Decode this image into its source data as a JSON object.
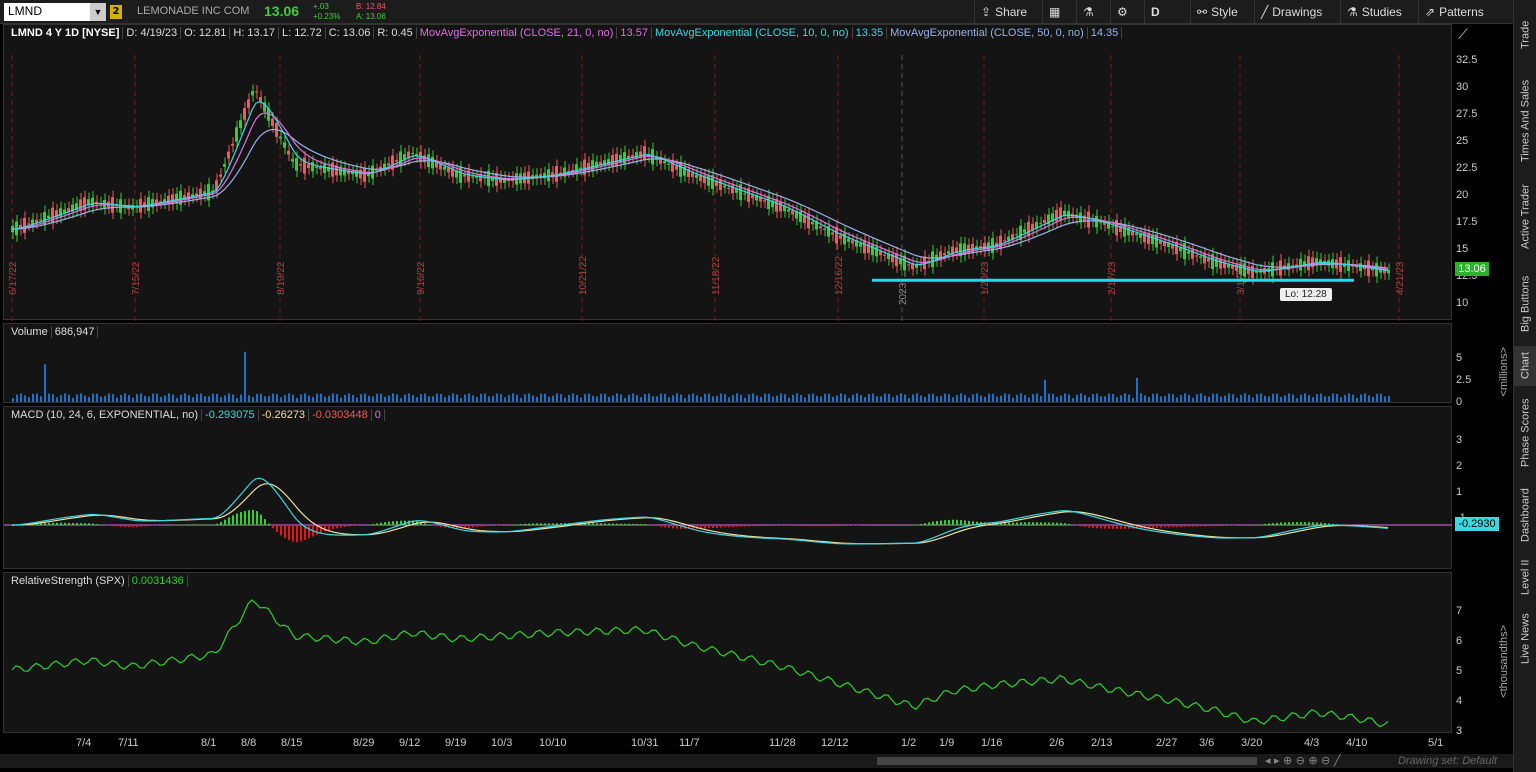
{
  "toolbar": {
    "symbol": "LMND",
    "link_badge": "2",
    "company": "LEMONADE INC COM",
    "last": "13.06",
    "change": "+.03",
    "change_pct": "+0.23%",
    "bid": "B: 12.84",
    "ask": "A: 13.06",
    "share": "Share",
    "period": "D",
    "style": "Style",
    "drawings": "Drawings",
    "studies": "Studies",
    "patterns": "Patterns"
  },
  "price_header": {
    "title": "LMND 4 Y 1D [NYSE]",
    "date": "D: 4/19/23",
    "open": "O: 12.81",
    "high": "H: 13.17",
    "low": "L: 12.72",
    "close": "C: 13.06",
    "range": "R: 0.45",
    "ema21": "MovAvgExponential (CLOSE, 21, 0, no)",
    "ema21_val": "13.57",
    "ema10": "MovAvgExponential (CLOSE, 10, 0, no)",
    "ema10_val": "13.35",
    "ema50": "MovAvgExponential (CLOSE, 50, 0, no)",
    "ema50_val": "14.35"
  },
  "price_axis": [
    "32.5",
    "30",
    "27.5",
    "25",
    "22.5",
    "20",
    "17.5",
    "15",
    "12.5",
    "10"
  ],
  "price_tag": "13.06",
  "low_label": "Lo: 12.28",
  "vertical_dates": [
    "6/17/22",
    "7/15/22",
    "8/19/22",
    "9/16/22",
    "10/21/22",
    "11/18/22",
    "12/16/22",
    "2023",
    "1/20/23",
    "2/17/23",
    "3/17/23",
    "4/21/23"
  ],
  "volume": {
    "label": "Volume",
    "value": "686,947",
    "axis": [
      "5",
      "2.5",
      "0"
    ],
    "unit": "<millions>"
  },
  "macd": {
    "label": "MACD (10, 24, 6, EXPONENTIAL, no)",
    "v1": "-0.293075",
    "v2": "-0.26273",
    "v3": "-0.0303448",
    "v4": "0",
    "axis": [
      "3",
      "2",
      "1",
      "-1"
    ],
    "tag": "-0.2930"
  },
  "rs": {
    "label": "RelativeStrength (SPX)",
    "value": "0.0031436",
    "axis": [
      "7",
      "6",
      "5",
      "4",
      "3"
    ],
    "unit": "<thousandths>"
  },
  "x_axis": [
    "7/4",
    "7/11",
    "8/1",
    "8/8",
    "8/15",
    "8/29",
    "9/12",
    "9/19",
    "10/3",
    "10/10",
    "10/31",
    "11/7",
    "11/28",
    "12/12",
    "1/2",
    "1/9",
    "1/16",
    "2/6",
    "2/13",
    "2/27",
    "3/6",
    "3/20",
    "4/3",
    "4/10",
    "5/1"
  ],
  "status": "Drawing set: Default",
  "sidebar": [
    "Trade",
    "Times And Sales",
    "Active Trader",
    "Big Buttons",
    "Chart",
    "Phase Scores",
    "Dashboard",
    "Level II",
    "Live News"
  ],
  "colors": {
    "up": "#2fd12f",
    "down": "#f05a5a",
    "ema10": "#3ad8e0",
    "ema21": "#e070e0",
    "ema50": "#9ab0e8",
    "macd": "#3ad8e0",
    "signal": "#f0e0a0",
    "rs": "#2fd12f",
    "volume": "#1e70c8",
    "support": "#19e0f0"
  },
  "chart_data": [
    {
      "type": "candlestick",
      "title": "LMND 4 Y 1D [NYSE]",
      "x": [
        "6/17",
        "7/4",
        "7/11",
        "8/1",
        "8/8",
        "8/15",
        "8/29",
        "9/12",
        "9/19",
        "10/3",
        "10/10",
        "10/31",
        "11/7",
        "11/28",
        "12/12",
        "1/2",
        "1/9",
        "1/16",
        "2/6",
        "2/13",
        "2/27",
        "3/6",
        "3/20",
        "4/3",
        "4/10",
        "4/19"
      ],
      "close": [
        17,
        19.5,
        19,
        20.5,
        30,
        23,
        22,
        24,
        22,
        21.5,
        22,
        24,
        22,
        19,
        16.5,
        13.5,
        15,
        15.5,
        18.5,
        17.5,
        15.5,
        14,
        13,
        14,
        13.5,
        13.06
      ],
      "ylim": [
        10,
        32.5
      ],
      "support_level": 12.28
    },
    {
      "type": "bar",
      "title": "Volume",
      "unit": "millions",
      "ylim": [
        0,
        5
      ]
    },
    {
      "type": "line",
      "title": "MACD (10, 24, 6, EXPONENTIAL, no)",
      "ylim": [
        -1.5,
        3.5
      ]
    },
    {
      "type": "line",
      "title": "RelativeStrength (SPX)",
      "unit": "thousandths",
      "ylim": [
        3,
        7.5
      ]
    }
  ]
}
